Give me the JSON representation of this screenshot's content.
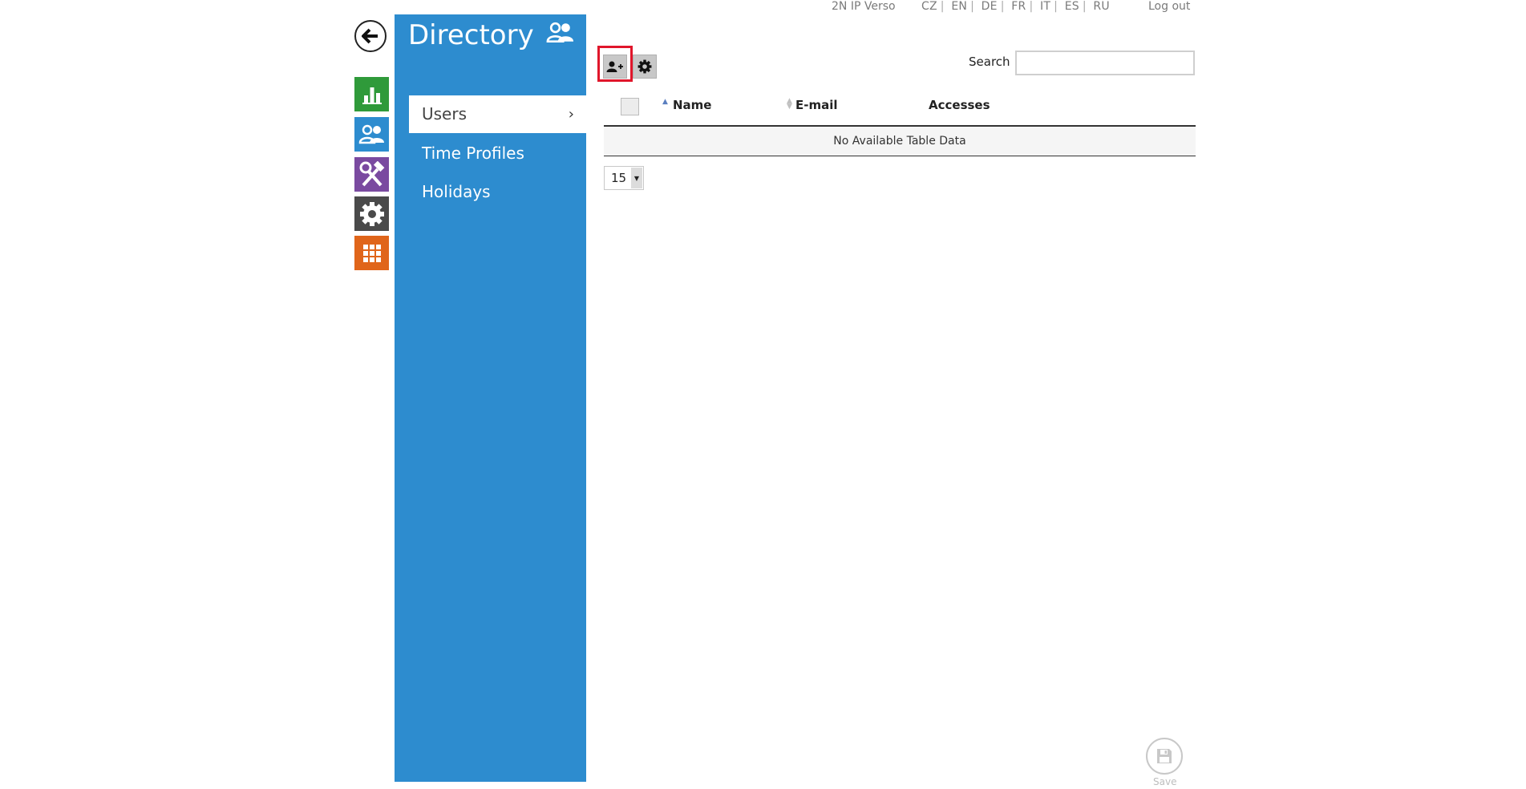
{
  "header": {
    "product_name": "2N IP Verso",
    "languages": [
      "CZ",
      "EN",
      "DE",
      "FR",
      "IT",
      "ES",
      "RU"
    ],
    "logout_label": "Log out"
  },
  "nav": {
    "back_icon": "arrow-left-icon",
    "tiles": [
      {
        "id": "status",
        "icon": "bar-chart-icon",
        "color": "#2f9a3a"
      },
      {
        "id": "directory",
        "icon": "users-icon",
        "color": "#2d8ccf"
      },
      {
        "id": "hardware",
        "icon": "tools-icon",
        "color": "#7a4aa0"
      },
      {
        "id": "system",
        "icon": "gear-icon",
        "color": "#4a4a4a"
      },
      {
        "id": "services",
        "icon": "grid-icon",
        "color": "#e0651a"
      }
    ]
  },
  "sidebar": {
    "title": "Directory",
    "title_icon": "users-icon",
    "accent_color": "#2d8ccf",
    "items": [
      {
        "label": "Users",
        "active": true
      },
      {
        "label": "Time Profiles",
        "active": false
      },
      {
        "label": "Holidays",
        "active": false
      }
    ],
    "chevron": "›"
  },
  "toolbar": {
    "add_user_icon": "add-user-icon",
    "settings_icon": "gear-icon",
    "highlight_color": "#e0162b"
  },
  "search": {
    "label": "Search",
    "value": "",
    "placeholder": ""
  },
  "table": {
    "columns": [
      "Name",
      "E-mail",
      "Accesses"
    ],
    "sorted_column": "Name",
    "sort_direction": "ascending",
    "empty_message": "No Available Table Data"
  },
  "pagination": {
    "page_size": "15"
  },
  "footer": {
    "save_label": "Save",
    "save_icon": "save-icon"
  }
}
